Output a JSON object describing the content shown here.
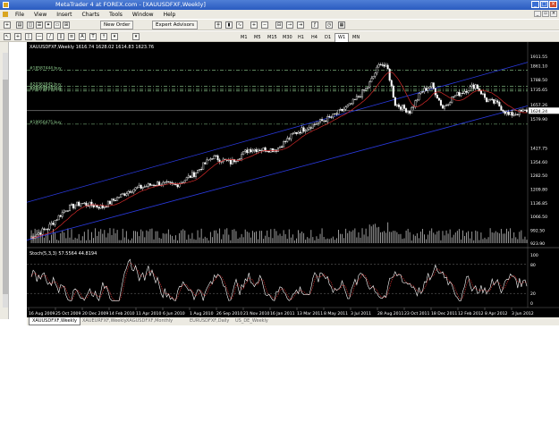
{
  "window": {
    "title": "MetaTrader 4 at FOREX.com - [XAUUSDFXF,Weekly]"
  },
  "menu": [
    "File",
    "View",
    "Insert",
    "Charts",
    "Tools",
    "Window",
    "Help"
  ],
  "toolbar": {
    "new_order": "New Order",
    "expert_advisors": "Expert Advisors"
  },
  "timeframes": [
    "M1",
    "M5",
    "M15",
    "M30",
    "H1",
    "H4",
    "D1",
    "W1",
    "MN"
  ],
  "active_timeframe": "W1",
  "chart": {
    "header": "XAUUSDFXF,Weekly  1616.74 1628.02 1614.83 1623.76",
    "levels": [
      {
        "label": "#18587444 buy",
        "price": 1839
      },
      {
        "label": "#20363945 buy",
        "price": 1754
      },
      {
        "label": "#20363945 buy",
        "price": 1737
      },
      {
        "label": "#20373019 buy",
        "price": 1728
      },
      {
        "label": "#19956475 buy",
        "price": 1553
      }
    ],
    "price_labels": [
      "1911.55",
      "1861.10",
      "1788.50",
      "1735.65",
      "1657.26",
      "1624.24",
      "1579.90",
      "1427.75",
      "1354.60",
      "1282.50",
      "1209.80",
      "1136.85",
      "1066.50",
      "992.50",
      "923.90"
    ],
    "current_price": "1624.24",
    "x_labels": [
      "16 Aug 2009",
      "25 Oct 2009",
      "20 Dec 2009",
      "14 Feb 2010",
      "11 Apr 2010",
      "6 Jun 2010",
      "1 Aug 2010",
      "26 Sep 2010",
      "21 Nov 2010",
      "16 Jan 2011",
      "13 Mar 2011",
      "8 May 2011",
      "3 Jul 2011",
      "28 Aug 2011",
      "23 Oct 2011",
      "18 Dec 2011",
      "12 Feb 2012",
      "8 Apr 2012",
      "3 Jun 2012"
    ],
    "stoch_header": "Stoch(5,3,3) 57.5564 44.8194",
    "stoch_labels": [
      "100",
      "80",
      "20",
      "0"
    ]
  },
  "tabs": [
    "XAUUSDFXF,Weekly",
    "XAUEURFXF,Weekly",
    "XAGUSDFXF,Monthly",
    "EURUSDFXF,Daily",
    "US_DE_Weekly"
  ],
  "active_tab": "XAUUSDFXF,Weekly",
  "colors": {
    "bg": "#000000",
    "candle": "#ffffff",
    "ma": "#d42a2a",
    "channel": "#2a3ae0",
    "level": "#8fce8f",
    "volume": "#a8a8a8",
    "stoch_main": "#ffffff",
    "stoch_signal": "#e03030"
  }
}
